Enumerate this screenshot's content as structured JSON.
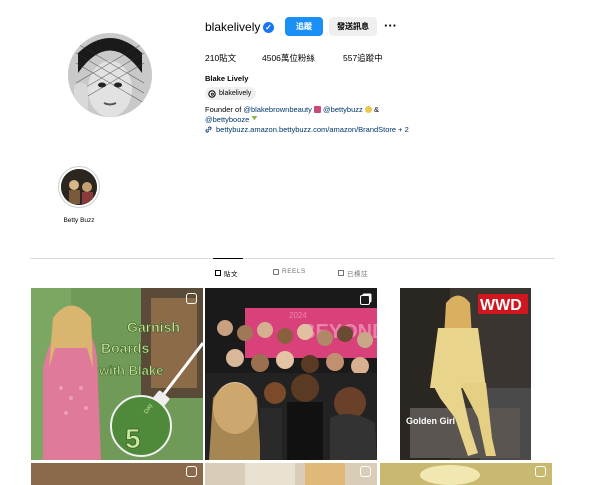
{
  "profile": {
    "username": "blakelively",
    "verified_mark": "✓",
    "follow_label": "追蹤",
    "message_label": "發送訊息",
    "more_label": "···",
    "stats": {
      "posts": "210貼文",
      "followers": "4506萬位粉絲",
      "following": "557追蹤中"
    },
    "full_name": "Blake Lively",
    "threads_handle": "blakelively",
    "bio": {
      "line1_prefix": "Founder of ",
      "mention1": "@blakebrownbeauty",
      "mention2": "@bettybuzz",
      "line1_sep": "&",
      "mention3": "@bettybooze",
      "link": "bettybuzz.amazon.bettybuzz.com/amazon/BrandStore + 2"
    }
  },
  "highlights": [
    {
      "label": "Betty Buzz"
    }
  ],
  "tabs": [
    {
      "label": "貼文",
      "icon": "grid-icon",
      "active": true
    },
    {
      "label": "REELS",
      "icon": "reels-icon",
      "active": false
    },
    {
      "label": "已標註",
      "icon": "tagged-icon",
      "active": false
    }
  ],
  "posts": [
    {
      "text1": "Garnish",
      "text2": "Boards",
      "text3": "with Blake",
      "day_label": "Day",
      "day_number": "5",
      "icon": "reel-icon"
    },
    {
      "banner": "BEYOND",
      "year": "2024",
      "icon": "multi-photo-icon"
    },
    {
      "brand": "WWD",
      "caption": "Golden Girl",
      "icon": "none"
    }
  ],
  "colors": {
    "accent": "#1a8ff5",
    "link": "#00376b",
    "post1_bg": "#6f9a57",
    "post1_text": "#c8e89a",
    "post2_banner": "#d9417a",
    "post3_bg": "#e8d48a",
    "wwd_red": "#e1141e"
  }
}
